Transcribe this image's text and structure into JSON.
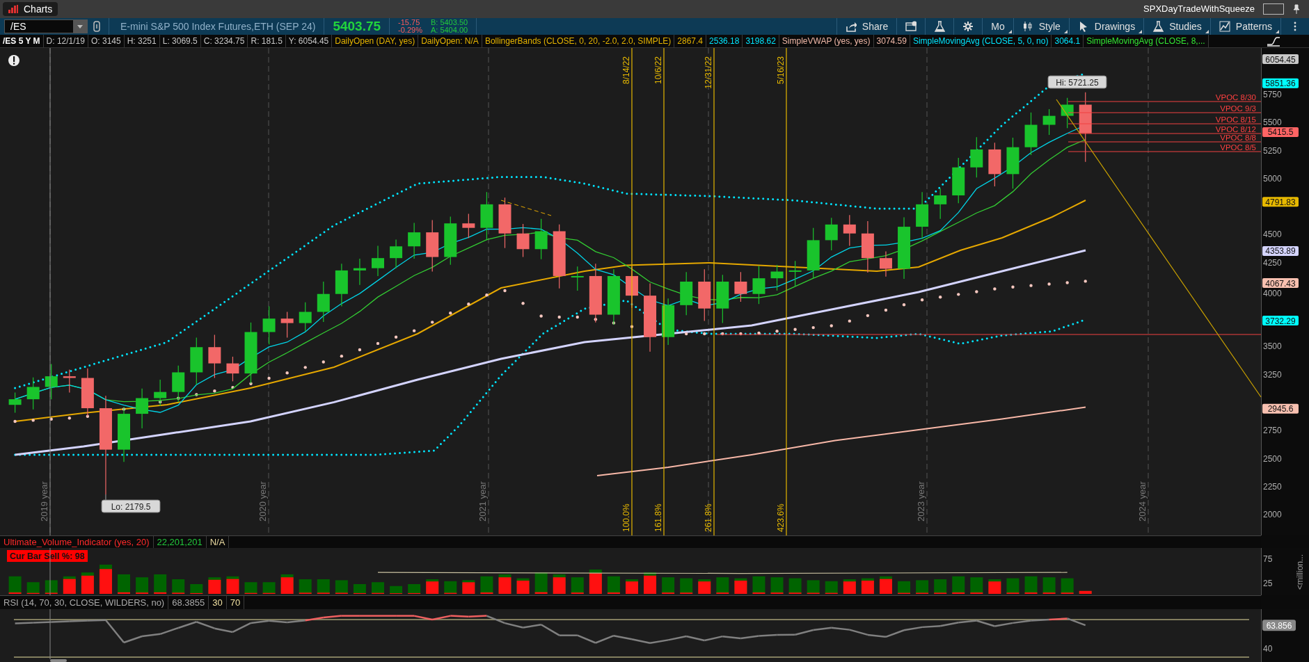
{
  "title_bar": {
    "title": "Charts",
    "layout_name": "SPXDayTradeWithSqueeze"
  },
  "symbol_bar": {
    "symbol": "/ES",
    "description": "E-mini S&P 500 Index Futures,ETH (SEP 24)",
    "last": "5403.75",
    "change": "-15.75",
    "change_percent": "-0.29%",
    "bid": "B: 5403.50",
    "ask": "A: 5404.00"
  },
  "toolbar": [
    {
      "kind": "share",
      "label": "Share",
      "menu": false
    },
    {
      "kind": "message",
      "menu": false
    },
    {
      "kind": "flask",
      "menu": false
    },
    {
      "kind": "gear",
      "menu": false
    },
    {
      "kind": "text",
      "label": "Mo",
      "menu": true
    },
    {
      "kind": "candles",
      "label": "Style",
      "menu": true
    },
    {
      "kind": "cursor",
      "label": "Drawings",
      "menu": true
    },
    {
      "kind": "flask",
      "label": "Studies",
      "menu": true
    },
    {
      "kind": "pattern",
      "label": "Patterns",
      "menu": true
    },
    {
      "kind": "kebab",
      "menu": false
    }
  ],
  "study_header": [
    {
      "text": "/ES 5 Y M",
      "color": "#ffffff"
    },
    {
      "text": "D: 12/1/19",
      "color": "#c8c8c8"
    },
    {
      "text": "O: 3145",
      "color": "#c8c8c8"
    },
    {
      "text": "H: 3251",
      "color": "#c8c8c8"
    },
    {
      "text": "L: 3069.5",
      "color": "#c8c8c8"
    },
    {
      "text": "C: 3234.75",
      "color": "#c8c8c8"
    },
    {
      "text": "R: 181.5",
      "color": "#c8c8c8"
    },
    {
      "text": "Y: 6054.45",
      "color": "#c8c8c8"
    },
    {
      "text": "DailyOpen (DAY, yes)",
      "color": "#e6b400"
    },
    {
      "text": "DailyOpen: N/A",
      "color": "#e6b400"
    },
    {
      "text": "BollingerBands (CLOSE, 0, 20, -2.0, 2.0, SIMPLE)",
      "color": "#e6b400"
    },
    {
      "text": "2867.4",
      "color": "#e6b400"
    },
    {
      "text": "2536.18",
      "color": "#00e5ff"
    },
    {
      "text": "3198.62",
      "color": "#00e5ff"
    },
    {
      "text": "SimpleVWAP (yes, yes)",
      "color": "#f0b8a8"
    },
    {
      "text": "3074.59",
      "color": "#f0b8a8"
    },
    {
      "text": "SimpleMovingAvg (CLOSE, 5, 0, no)",
      "color": "#00e5ff"
    },
    {
      "text": "3064.1",
      "color": "#00e5ff"
    },
    {
      "text": "SimpleMovingAvg (CLOSE, 8,...",
      "color": "#33e633"
    }
  ],
  "price_chart": {
    "date_lines": [
      {
        "date": "8/14/22",
        "ratio": "100.0%"
      },
      {
        "date": "10/6/22",
        "ratio": "161.8%"
      },
      {
        "date": "12/31/22",
        "ratio": "261.8%"
      },
      {
        "date": "5/16/23",
        "ratio": "423.6%"
      }
    ],
    "year_labels": [
      "2019 year",
      "2020 year",
      "2021 year",
      "2023 year",
      "2024 year"
    ],
    "vpoc_labels": [
      "VPOC 8/30",
      "VPOC 9/3",
      "VPOC 8/15",
      "VPOC 8/12",
      "VPOC 8/8",
      "VPOC 8/5"
    ],
    "high_label": "Hi: 5721.25",
    "low_label": "Lo: 2179.5",
    "axis_ticks": [
      "5750",
      "5500",
      "5250",
      "5000",
      "4500",
      "4250",
      "4000",
      "3500",
      "3250",
      "2750",
      "2500",
      "2250",
      "2000"
    ],
    "axis_markers": [
      {
        "text": "6054.45",
        "color": "#c8c8c8"
      },
      {
        "text": "5851.36",
        "color": "#00ffff"
      },
      {
        "text": "5415.5",
        "color": "#ff6464"
      },
      {
        "text": "4791.83",
        "color": "#e6b800"
      },
      {
        "text": "4353.89",
        "color": "#d4d4ff"
      },
      {
        "text": "4067.43",
        "color": "#f8c0b0"
      },
      {
        "text": "3732.29",
        "color": "#00ffff"
      },
      {
        "text": "2945.6",
        "color": "#f8c0b0"
      }
    ]
  },
  "volume_panel": {
    "study": "Ultimate_Volume_Indicator (yes, 20)",
    "value": "22,201,201",
    "extra": "N/A",
    "badge": "Cur Bar Sell %: 98",
    "axis_ticks": [
      "75",
      "25"
    ],
    "unit": "<million..."
  },
  "rsi_panel": {
    "study": "RSI (14, 70, 30, CLOSE, WILDERS, no)",
    "value": "68.3855",
    "levels": [
      "30",
      "70"
    ],
    "marker": "63.856",
    "axis_ticks": [
      "40"
    ]
  }
}
